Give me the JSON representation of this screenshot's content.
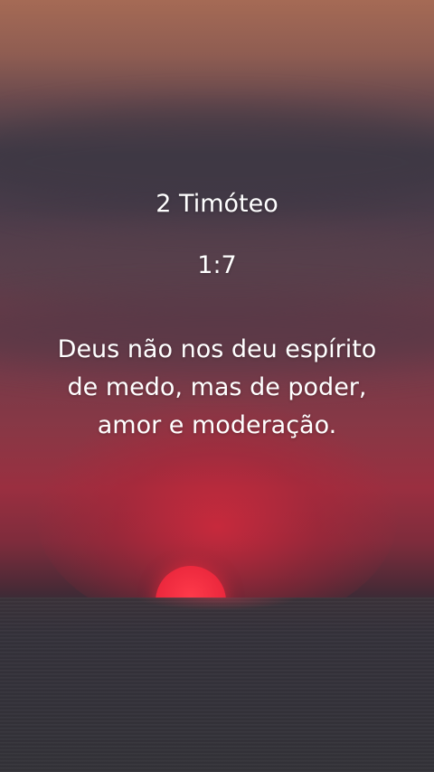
{
  "reference": {
    "book": "2 Timóteo",
    "verse": "1:7"
  },
  "quote": {
    "lines": [
      "Deus não nos deu espírito",
      "de medo, mas de poder,",
      "amor e moderação."
    ]
  },
  "colors": {
    "sky_top": "#a56a55",
    "sky_mid": "#453d49",
    "glow": "#9a2f40",
    "sun": "#e01e36",
    "sea": "#333238",
    "text": "#ffffff"
  }
}
